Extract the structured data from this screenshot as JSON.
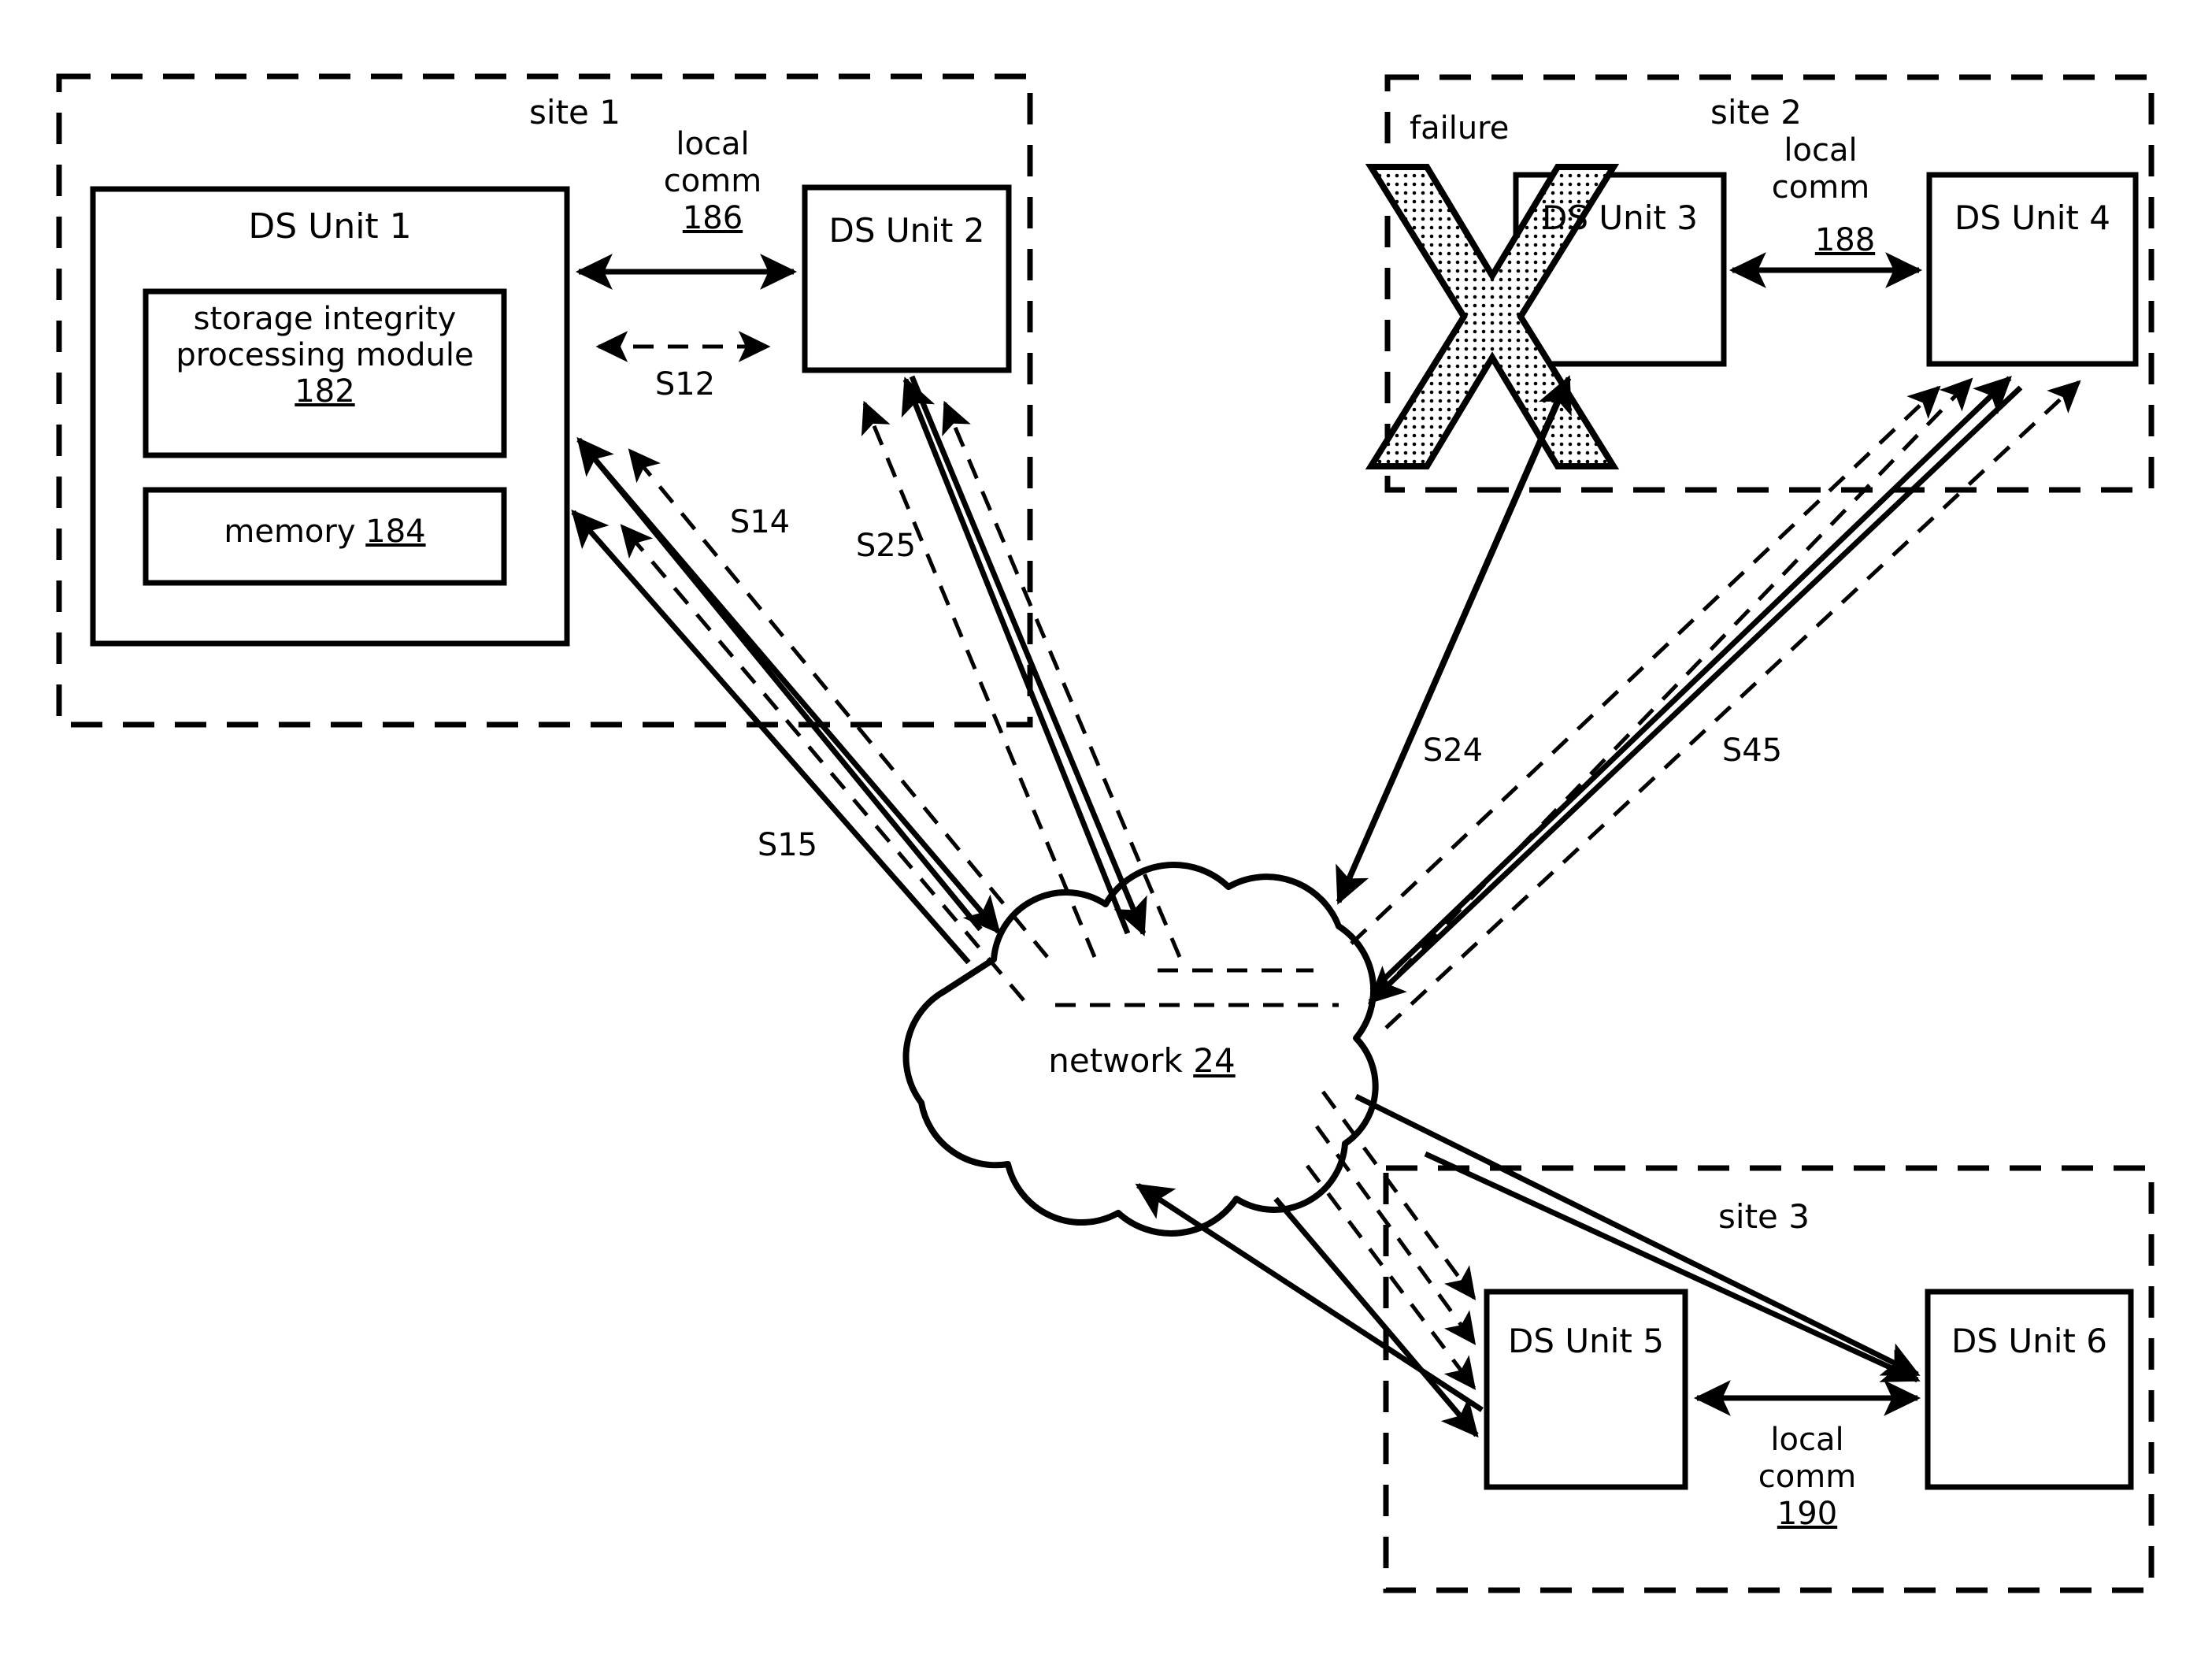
{
  "diagram": {
    "title": "distributed storage sites rebuild diagram",
    "colors": {
      "stroke": "#000000",
      "background": "#ffffff",
      "x_fill_pattern": "dotted"
    }
  },
  "sites": [
    {
      "id": "site-1",
      "label": "site 1",
      "units": [
        {
          "id": "ds-unit-1",
          "label": "DS Unit 1",
          "children": [
            {
              "id": "storage-integrity-processing-module",
              "label_line1": "storage integrity",
              "label_line2": "processing module",
              "ref": "182"
            },
            {
              "id": "memory",
              "label": "memory",
              "ref": "184"
            }
          ]
        },
        {
          "id": "ds-unit-2",
          "label": "DS Unit 2"
        }
      ],
      "local_comm": {
        "label_line1": "local",
        "label_line2": "comm",
        "ref": "186"
      }
    },
    {
      "id": "site-2",
      "label": "site 2",
      "failure_label": "failure",
      "units": [
        {
          "id": "ds-unit-3",
          "label": "DS Unit 3",
          "failed": true
        },
        {
          "id": "ds-unit-4",
          "label": "DS Unit 4"
        }
      ],
      "local_comm": {
        "label_line1": "local",
        "label_line2": "comm",
        "ref": "188"
      }
    },
    {
      "id": "site-3",
      "label": "site 3",
      "units": [
        {
          "id": "ds-unit-5",
          "label": "DS Unit 5"
        },
        {
          "id": "ds-unit-6",
          "label": "DS Unit 6"
        }
      ],
      "local_comm": {
        "label_line1": "local",
        "label_line2": "comm",
        "ref": "190"
      }
    }
  ],
  "network": {
    "id": "network-cloud",
    "label": "network",
    "ref": "24"
  },
  "slice_labels": [
    {
      "id": "s12",
      "label": "S12"
    },
    {
      "id": "s14",
      "label": "S14"
    },
    {
      "id": "s25",
      "label": "S25"
    },
    {
      "id": "s15",
      "label": "S15"
    },
    {
      "id": "s24",
      "label": "S24"
    },
    {
      "id": "s45",
      "label": "S45"
    }
  ]
}
